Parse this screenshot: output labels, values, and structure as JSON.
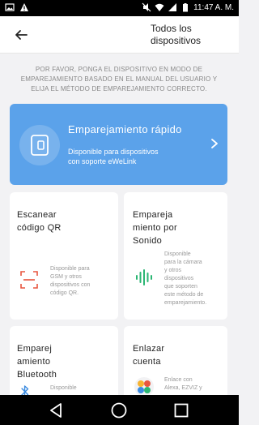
{
  "status_bar": {
    "left_icons": [
      "image-icon",
      "warning-icon"
    ],
    "right_icons": [
      "mute-icon",
      "wifi-icon",
      "signal-icon",
      "battery-icon"
    ],
    "time": "11:47 A. M."
  },
  "header": {
    "title_line1": "Todos los",
    "title_line2": "dispositivos"
  },
  "instructions": "POR FAVOR, PONGA EL DISPOSITIVO EN MODO DE EMPAREJAMIENTO BASADO EN EL MANUAL DEL USUARIO Y ELIJA EL MÉTODO DE EMPAREJAMIENTO CORRECTO.",
  "quick_pair": {
    "title": "Emparejamiento rápido",
    "desc_line1": "Disponible para dispositivos",
    "desc_line2": "con soporte eWeLink",
    "color": "#5ba2ea"
  },
  "cards": {
    "qr": {
      "title_line1": "Escanear",
      "title_line2": "código QR",
      "desc": [
        "Disponible para",
        "GSM y otros",
        "dispositivos con",
        "código QR."
      ],
      "icon_color": "#e8553f"
    },
    "sound": {
      "title_line1": "Empareja",
      "title_line2": "miento por",
      "title_line3": "Sonido",
      "desc": [
        "Disponible",
        "para la cámara",
        "y otros",
        "dispositivos",
        "que soporten",
        "este método de",
        "emparejamiento."
      ],
      "icon_color": "#2bb673"
    },
    "bluetooth": {
      "title_line1": "Emparej",
      "title_line2": "amiento",
      "title_line3": "Bluetooth",
      "desc": [
        "Disponible"
      ],
      "icon_color": "#3a8be0"
    },
    "link": {
      "title_line1": "Enlazar",
      "title_line2": "cuenta",
      "desc": [
        "Enlace con",
        "Alexa, EZVIZ y"
      ]
    }
  },
  "nav": {
    "icons": [
      "back-triangle-icon",
      "home-circle-icon",
      "recents-square-icon"
    ]
  }
}
